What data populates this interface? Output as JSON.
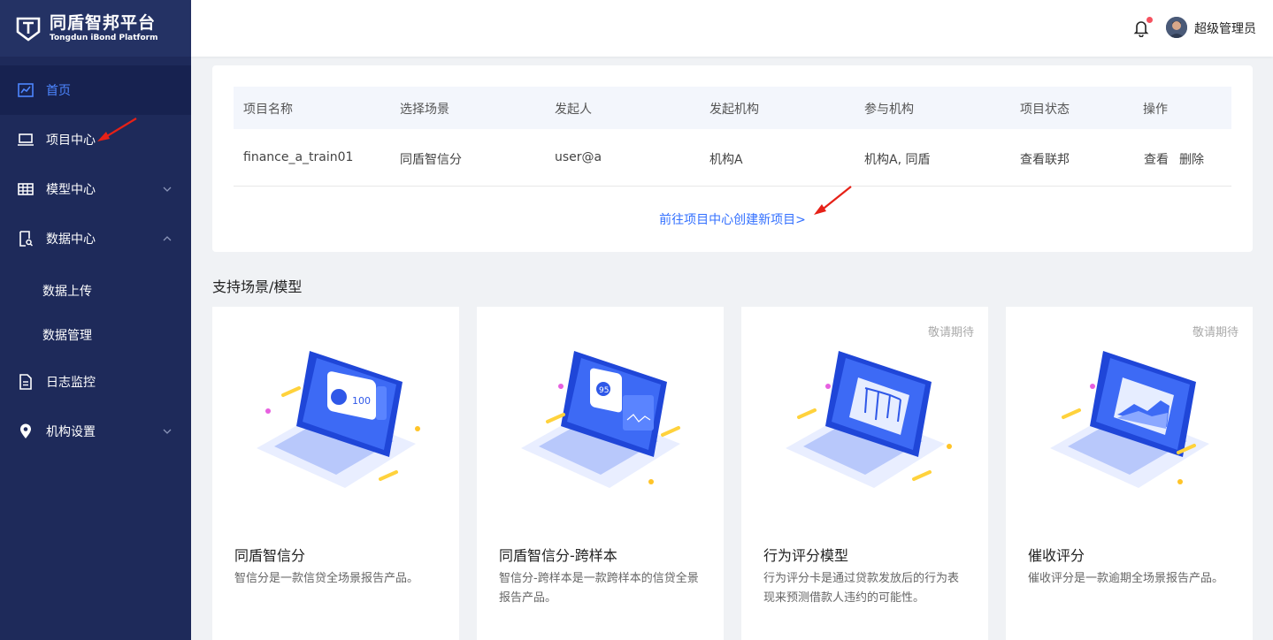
{
  "brand": {
    "name_cn": "同盾智邦平台",
    "name_en": "Tongdun iBond Platform"
  },
  "sidebar": {
    "items": [
      {
        "label": "首页",
        "icon": "chart-line-icon",
        "active": true
      },
      {
        "label": "项目中心",
        "icon": "laptop-icon"
      },
      {
        "label": "模型中心",
        "icon": "grid-icon",
        "expandable": true,
        "expanded": false
      },
      {
        "label": "数据中心",
        "icon": "document-search-icon",
        "expandable": true,
        "expanded": true
      },
      {
        "label": "日志监控",
        "icon": "file-icon"
      },
      {
        "label": "机构设置",
        "icon": "location-pin-icon",
        "expandable": true,
        "expanded": false
      }
    ],
    "sub_items": [
      {
        "label": "数据上传"
      },
      {
        "label": "数据管理"
      }
    ]
  },
  "header": {
    "username": "超级管理员",
    "notification_dot": true
  },
  "project_table": {
    "columns": [
      "项目名称",
      "选择场景",
      "发起人",
      "发起机构",
      "参与机构",
      "项目状态",
      "操作"
    ],
    "rows": [
      {
        "name": "finance_a_train01",
        "scene": "同盾智信分",
        "initiator": "user@a",
        "initiating_org": "机构A",
        "participants": "机构A, 同盾",
        "status_link": "查看联邦",
        "action_view": "查看",
        "action_delete": "删除"
      }
    ],
    "create_link": "前往项目中心创建新项目>"
  },
  "section_title": "支持场景/模型",
  "scenarios": [
    {
      "title": "同盾智信分",
      "desc": "智信分是一款信贷全场景报告产品。",
      "badge": ""
    },
    {
      "title": "同盾智信分-跨样本",
      "desc": "智信分-跨样本是一款跨样本的信贷全景报告产品。",
      "badge": ""
    },
    {
      "title": "行为评分模型",
      "desc": "行为评分卡是通过贷款发放后的行为表现来预测借款人违约的可能性。",
      "badge": "敬请期待"
    },
    {
      "title": "催收评分",
      "desc": "催收评分是一款逾期全场景报告产品。",
      "badge": "敬请期待"
    }
  ],
  "colors": {
    "sidebar_bg": "#1e2a5a",
    "accent": "#3370ff",
    "danger": "#f5515f",
    "annotation_arrow": "#e62117"
  }
}
